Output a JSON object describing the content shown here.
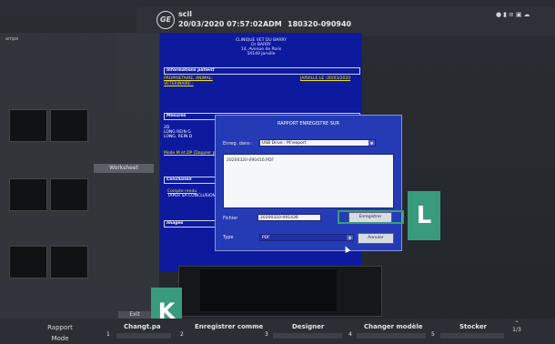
{
  "topbar": {
    "patient": "scil",
    "datetime": "20/03/2020 07:57:02ADM",
    "exam_id": "180320-090940",
    "logo": "GE"
  },
  "sidebar": {
    "label": "ampe",
    "worksheet": "Worksheet",
    "exit": "Exit"
  },
  "report": {
    "clinic_lines": [
      "CLINIQUE VET DU BARRY",
      "Dr BARRY",
      "14, Avenue de Paris",
      "54140 Jarville"
    ],
    "sections": {
      "info": "Informations patient",
      "measures": "Mesures",
      "conclusion": "Conclusion",
      "images": "Images"
    },
    "owner_label": "PROPRIETAIRE, ANIMAL:",
    "vet_label": "VETERINAIRE :",
    "date_text": "JARVILLE LE :20/03/2020",
    "measure_lines": [
      "2D",
      "LONG REIN G",
      "LONG. REIN D"
    ],
    "mode_text": "Mode M et DP (Doppler pu",
    "conclusion_label": "Compte rendu",
    "conclusion_text": "TAPER SA CONCLUSION"
  },
  "dialog": {
    "title": "RAPPORT ENREGISTRE SUR",
    "save_in_label": "Enreg. dans :",
    "save_in_value": "USB Drive : M:\\export",
    "file_item": "20200320-090416.PDF",
    "filename_label": "Fichier",
    "filename_value": "20200320-091436",
    "save_button": "Enregistrer",
    "type_label": "Type",
    "type_value": "PDF",
    "cancel_button": "Annuler"
  },
  "callouts": {
    "K": "K",
    "L": "L"
  },
  "bottombar": {
    "rapport_line1": "Rapport",
    "rapport_line2": "Mode",
    "items": [
      {
        "num": "1",
        "label": "Changt.pa"
      },
      {
        "num": "2",
        "label": "Enregistrer comme"
      },
      {
        "num": "3",
        "label": "Designer"
      },
      {
        "num": "4",
        "label": "Changer modèle"
      },
      {
        "num": "5",
        "label": "Stocker"
      }
    ],
    "page": "1/3"
  }
}
